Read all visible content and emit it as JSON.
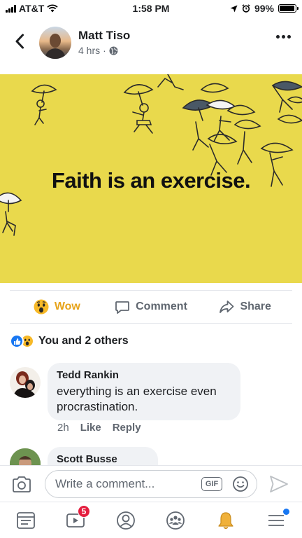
{
  "status_bar": {
    "carrier": "AT&T",
    "time": "1:58 PM",
    "battery": "99%"
  },
  "post": {
    "author": "Matt Tiso",
    "time": "4 hrs",
    "image_text": "Faith is an exercise."
  },
  "actions": {
    "wow": "Wow",
    "comment": "Comment",
    "share": "Share"
  },
  "reactions": {
    "summary": "You and 2 others"
  },
  "comments": [
    {
      "author": "Tedd Rankin",
      "text_line1": "everything is an exercise even",
      "text_line2": "procrastination.",
      "time": "2h",
      "like": "Like",
      "reply": "Reply"
    },
    {
      "author": "Scott Busse"
    }
  ],
  "composer": {
    "placeholder": "Write a comment...",
    "gif": "GIF"
  },
  "nav": {
    "video_badge": "5"
  },
  "colors": {
    "brand": "#1877f2",
    "wow": "#e7a41b",
    "image_bg": "#e9d94c",
    "badge": "#e41e3f"
  }
}
